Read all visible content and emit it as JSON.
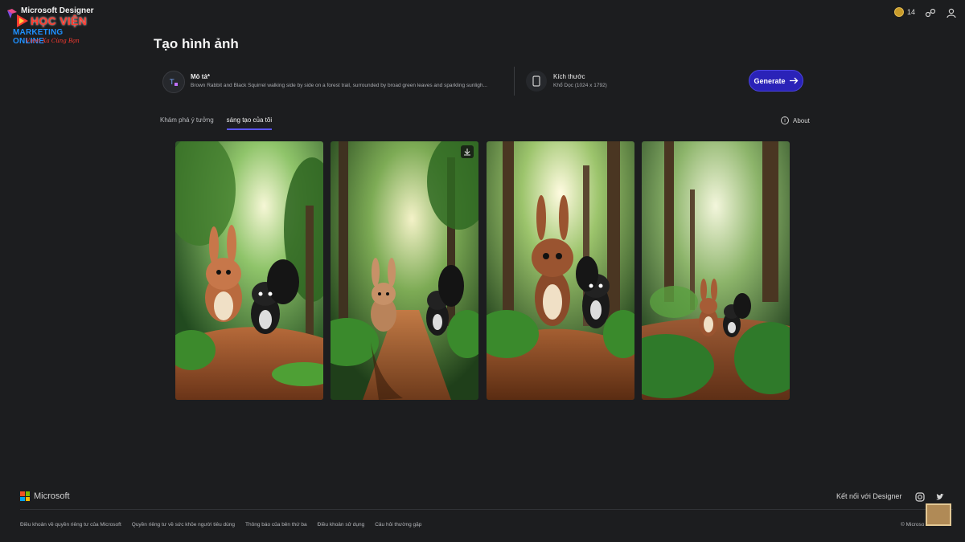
{
  "app": {
    "brand": "Microsoft Designer",
    "credits": "14"
  },
  "watermark": {
    "line1": "HỌC VIỆN",
    "line2": "MARKETING ONLINE",
    "line3": "Vươn Xa Cùng Bạn"
  },
  "page": {
    "title": "Tạo hình ảnh"
  },
  "prompt": {
    "label": "Mô tả*",
    "text": "Brown Rabbit and Black Squirrel walking side by side on a forest trail, surrounded by broad green leaves and sparkling sunligh...",
    "size_label": "Kích thước",
    "size_value": "Khổ Dọc (1024 x 1792)",
    "generate": "Generate"
  },
  "tabs": [
    {
      "label": "Khám phá ý tưởng",
      "active": false
    },
    {
      "label": "sáng tạo của tôi",
      "active": true
    }
  ],
  "about": "About",
  "footer": {
    "logo_text": "Microsoft",
    "connect": "Kết nối với Designer",
    "links": [
      "Điều khoản về quyền riêng tư của Microsoft",
      "Quyền riêng tư về sức khỏe người tiêu dùng",
      "Thông báo của bên thứ ba",
      "Điều khoản sử dụng",
      "Câu hỏi thường gặp"
    ],
    "copyright": "© Microso"
  },
  "colors": {
    "background": "#1c1d1f",
    "accent": "#2a22b8",
    "tab_underline": "#5b55f0"
  }
}
